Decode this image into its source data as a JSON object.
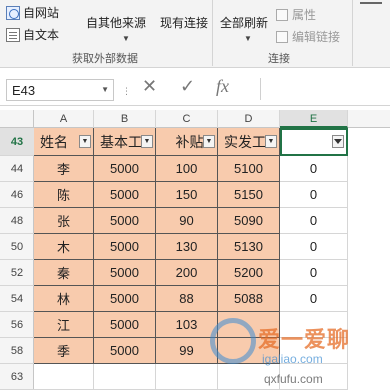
{
  "ribbon": {
    "from_web": "自网站",
    "from_text": "自文本",
    "other_sources": "自其他来源",
    "existing_connections": "现有连接",
    "refresh_all": "全部刷新",
    "properties": "属性",
    "edit_links": "编辑链接",
    "group_get_external": "获取外部数据",
    "group_connections": "连接",
    "truncated_top": "连接"
  },
  "formula_bar": {
    "name_box": "E43",
    "cancel_symbol": "✕",
    "enter_symbol": "✓",
    "fx_label": "fx",
    "formula": ""
  },
  "columns": [
    "A",
    "B",
    "C",
    "D",
    "E"
  ],
  "rows": [
    "43",
    "44",
    "46",
    "48",
    "50",
    "52",
    "54",
    "56",
    "58",
    "63"
  ],
  "table": {
    "headers": [
      "姓名",
      "基本工",
      "补贴",
      "实发工"
    ],
    "data": [
      {
        "name": "李",
        "base": "5000",
        "allowance": "100",
        "net": "5100",
        "e": "0"
      },
      {
        "name": "陈",
        "base": "5000",
        "allowance": "150",
        "net": "5150",
        "e": "0"
      },
      {
        "name": "张",
        "base": "5000",
        "allowance": "90",
        "net": "5090",
        "e": "0"
      },
      {
        "name": "木",
        "base": "5000",
        "allowance": "130",
        "net": "5130",
        "e": "0"
      },
      {
        "name": "秦",
        "base": "5000",
        "allowance": "200",
        "net": "5200",
        "e": "0"
      },
      {
        "name": "林",
        "base": "5000",
        "allowance": "88",
        "net": "5088",
        "e": "0"
      },
      {
        "name": "江",
        "base": "5000",
        "allowance": "103",
        "net": "",
        "e": ""
      },
      {
        "name": "季",
        "base": "5000",
        "allowance": "99",
        "net": "",
        "e": ""
      }
    ]
  },
  "watermark": {
    "line1": "爱一爱聊",
    "line2": "igaliao.com",
    "line3": "qxfufu.com"
  },
  "colors": {
    "accent": "#217346",
    "table_fill": "#f8cbad"
  }
}
